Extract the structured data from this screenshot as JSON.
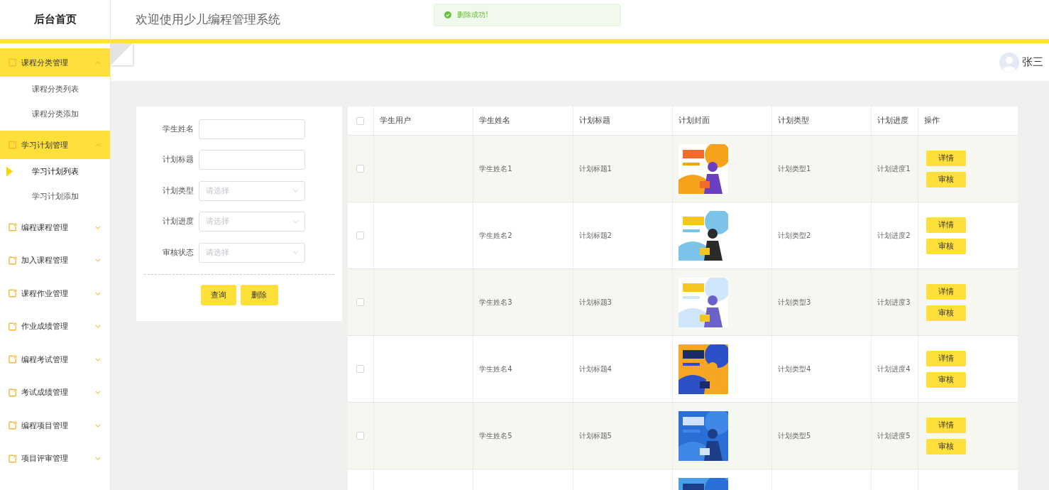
{
  "brand": "后台首页",
  "header_title": "欢迎使用少儿编程管理系统",
  "toast": {
    "message": "删除成功!"
  },
  "user": {
    "name": "张三"
  },
  "sidebar": {
    "items": [
      {
        "label": "课程分类管理",
        "expanded": true,
        "children": [
          {
            "label": "课程分类列表",
            "selected": false
          },
          {
            "label": "课程分类添加",
            "selected": false
          }
        ]
      },
      {
        "label": "学习计划管理",
        "expanded": true,
        "children": [
          {
            "label": "学习计划列表",
            "selected": true
          },
          {
            "label": "学习计划添加",
            "selected": false
          }
        ]
      },
      {
        "label": "编程课程管理",
        "expanded": false
      },
      {
        "label": "加入课程管理",
        "expanded": false
      },
      {
        "label": "课程作业管理",
        "expanded": false
      },
      {
        "label": "作业成绩管理",
        "expanded": false
      },
      {
        "label": "编程考试管理",
        "expanded": false
      },
      {
        "label": "考试成绩管理",
        "expanded": false
      },
      {
        "label": "编程项目管理",
        "expanded": false
      },
      {
        "label": "项目评审管理",
        "expanded": false
      }
    ]
  },
  "search": {
    "fields": [
      {
        "label": "学生姓名",
        "kind": "input"
      },
      {
        "label": "计划标题",
        "kind": "input"
      },
      {
        "label": "计划类型",
        "kind": "select",
        "placeholder": "请选择"
      },
      {
        "label": "计划进度",
        "kind": "select",
        "placeholder": "请选择"
      },
      {
        "label": "审核状态",
        "kind": "select",
        "placeholder": "请选择"
      }
    ],
    "buttons": [
      "查询",
      "删除"
    ]
  },
  "table": {
    "all_checked": false,
    "columns": [
      "学生用户",
      "学生姓名",
      "计划标题",
      "计划封面",
      "计划类型",
      "计划进度",
      "操作"
    ],
    "rows": [
      {
        "checked": false,
        "student_name": "学生姓名1",
        "plan_title": "计划标题1",
        "cover": {
          "kind": "picture"
        },
        "plan_type": "计划类型1",
        "plan_progress": "计划进度1",
        "actions": [
          "详情",
          "审核"
        ]
      },
      {
        "checked": false,
        "student_name": "学生姓名2",
        "plan_title": "计划标题2",
        "cover": {
          "kind": "picture"
        },
        "plan_type": "计划类型2",
        "plan_progress": "计划进度2",
        "actions": [
          "详情",
          "审核"
        ]
      },
      {
        "checked": false,
        "student_name": "学生姓名3",
        "plan_title": "计划标题3",
        "cover": {
          "kind": "picture"
        },
        "plan_type": "计划类型3",
        "plan_progress": "计划进度3",
        "actions": [
          "详情",
          "审核"
        ]
      },
      {
        "checked": false,
        "student_name": "学生姓名4",
        "plan_title": "计划标题4",
        "cover": {
          "kind": "picture"
        },
        "plan_type": "计划类型4",
        "plan_progress": "计划进度4",
        "actions": [
          "详情",
          "审核"
        ]
      },
      {
        "checked": false,
        "student_name": "学生姓名5",
        "plan_title": "计划标题5",
        "cover": {
          "kind": "picture"
        },
        "plan_type": "计划类型5",
        "plan_progress": "计划进度5",
        "actions": [
          "详情",
          "审核"
        ]
      },
      {
        "cover": {
          "kind": "picture"
        }
      }
    ]
  }
}
